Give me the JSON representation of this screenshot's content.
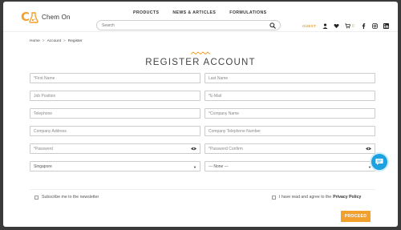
{
  "header": {
    "logo_text": "Chem On",
    "nav": [
      "PRODUCTS",
      "NEWS & ARTICLES",
      "FORMULATIONS"
    ],
    "search_placeholder": "Search",
    "guest_label": "GUEST",
    "cart_count": "0"
  },
  "breadcrumb": [
    "Home",
    ">",
    "Account",
    ">",
    "Register"
  ],
  "page_title": "REGISTER ACCOUNT",
  "form": {
    "first_name": "*First Name",
    "last_name": "Last Name",
    "job_position": "Job Position",
    "email": "*E-Mail",
    "telephone": "Telephone",
    "company_name": "*Company Name",
    "company_address": "Company Address",
    "company_telephone": "Company Telephone Number",
    "password": "*Password",
    "password_confirm": "*Password Confirm",
    "country_selected": "Singapore",
    "region_selected": "--- None ---"
  },
  "newsletter_label": "Subscribe me to the newsletter",
  "privacy_prefix": "I have read and agree to the",
  "privacy_link": "Privacy Policy",
  "proceed_label": "PROCEED",
  "colors": {
    "accent": "#f2a12c",
    "help": "#1da1e0"
  }
}
